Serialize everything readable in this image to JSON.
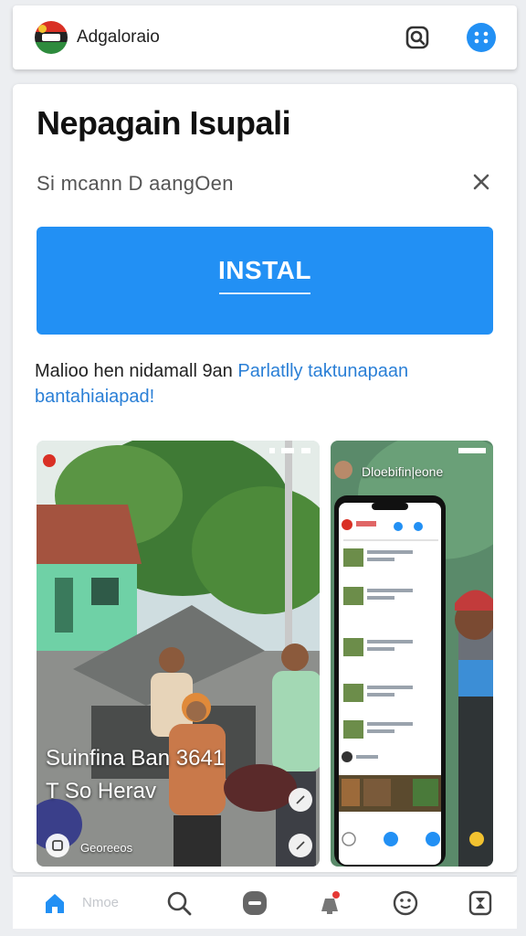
{
  "header": {
    "app_name": "Adgaloraio",
    "icons": [
      "logo-icon",
      "search-square-icon",
      "menu-dots-icon"
    ],
    "accent_color": "#2290f4"
  },
  "app_card": {
    "title": "Nepagain Isupali",
    "subtitle": "Si mcann D aangOen",
    "install_label": "INSTAL",
    "description": "Malioo hen nidamall 9an",
    "description_link": "Parlatlly taktunapaan bantahiaiapad!"
  },
  "screenshots": {
    "first": {
      "caption_line1": "Suinfina Ban 3641",
      "caption_line2": "T So Herav",
      "caption_small": "Georeeos"
    },
    "second": {
      "title": "Dloebifin|eone"
    }
  },
  "bottom_nav": {
    "home_label": "Nmoe",
    "items": [
      "home-icon",
      "search-icon",
      "minus-circle-icon",
      "notification-icon",
      "smile-icon",
      "hourglass-icon"
    ],
    "badge_color": "#e53935"
  }
}
